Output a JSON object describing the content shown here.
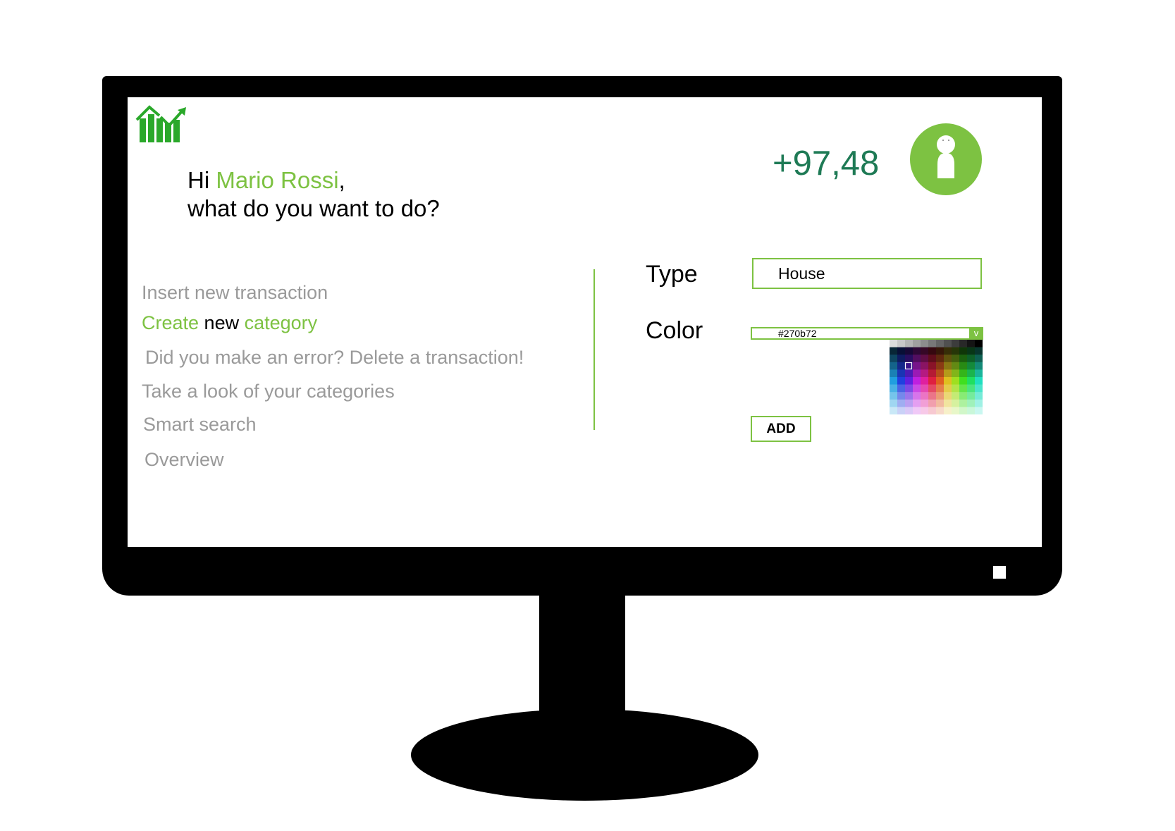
{
  "greeting": {
    "hi": "Hi ",
    "user_name": "Mario Rossi",
    "comma": ",",
    "question": "what do you want to do?"
  },
  "balance": "+97,48",
  "menu": [
    {
      "label": "Insert new transaction"
    },
    {
      "label_parts": [
        "Create",
        " new ",
        "category"
      ]
    },
    {
      "label": "Did you make an error? Delete a transaction!"
    },
    {
      "label": "Take a look of your categories"
    },
    {
      "label": "Smart search"
    },
    {
      "label": "Overview"
    }
  ],
  "form": {
    "type_label": "Type",
    "type_value": "House",
    "color_label": "Color",
    "color_value": "#270b72",
    "color_caret": "v",
    "add_label": "ADD"
  },
  "colors": {
    "accent": "#7dc242",
    "balance": "#1e7a55",
    "menu_text": "#9a9a9a"
  },
  "icons": {
    "logo": "bar-chart-trend-icon",
    "avatar": "user-icon",
    "dropdown": "chevron-down-icon"
  }
}
